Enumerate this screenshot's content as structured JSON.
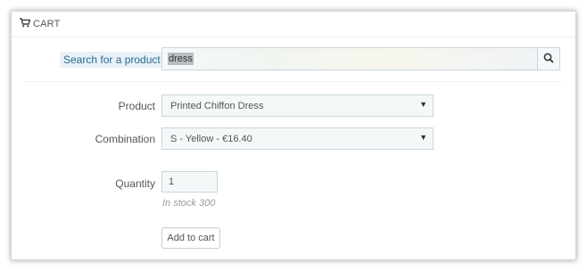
{
  "header": {
    "title": "CART",
    "icon": "shopping-cart-icon"
  },
  "search": {
    "label": "Search for a product",
    "value": "dress",
    "button_icon": "search-icon"
  },
  "product": {
    "label": "Product",
    "selected": "Printed Chiffon Dress"
  },
  "combination": {
    "label": "Combination",
    "selected": "S - Yellow - €16.40"
  },
  "quantity": {
    "label": "Quantity",
    "value": "1",
    "stock_note": "In stock 300"
  },
  "add_button": {
    "label": "Add to cart"
  },
  "colors": {
    "label_highlight_bg": "#e8f1f7",
    "label_highlight_text": "#2b6a95",
    "input_border": "#c7d6db"
  }
}
